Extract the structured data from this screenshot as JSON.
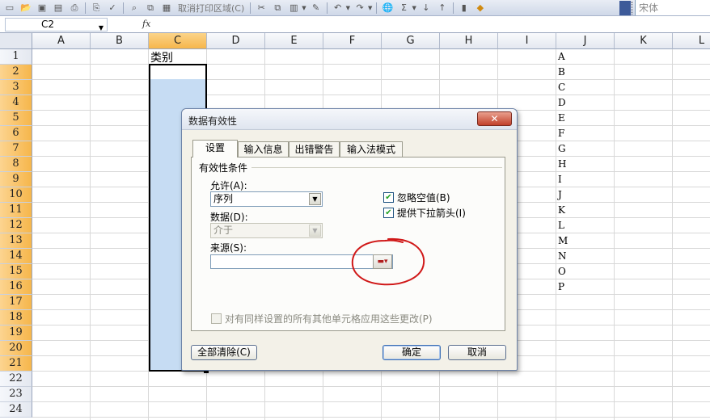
{
  "toolbar": {
    "cancel_print_area_label": "取消打印区域(C)",
    "font_name": "宋体",
    "icons": [
      "new-icon",
      "open-icon",
      "save-icon",
      "permission-icon",
      "print-icon",
      "print-preview-icon",
      "spelling-icon",
      "research-icon",
      "copy-icon",
      "paste-icon",
      "cut-icon",
      "paste-special-icon",
      "format-painter-icon",
      "undo-icon",
      "redo-icon",
      "hyperlink-icon",
      "autosum-icon",
      "sort-asc-icon",
      "sort-desc-icon",
      "chart-icon",
      "drawing-icon"
    ]
  },
  "formula_bar": {
    "cell_ref": "C2",
    "fx_label": "fx",
    "value": ""
  },
  "grid": {
    "columns": [
      "A",
      "B",
      "C",
      "D",
      "E",
      "F",
      "G",
      "H",
      "I",
      "J",
      "K",
      "L"
    ],
    "rows": [
      "1",
      "2",
      "3",
      "4",
      "5",
      "6",
      "7",
      "8",
      "9",
      "10",
      "11",
      "12",
      "13",
      "14",
      "15",
      "16",
      "17",
      "18",
      "19",
      "20",
      "21",
      "22",
      "23",
      "24"
    ],
    "selected_column": "C",
    "c1": "类别",
    "column_j": [
      "A",
      "B",
      "C",
      "D",
      "E",
      "F",
      "G",
      "H",
      "I",
      "J",
      "K",
      "L",
      "M",
      "N",
      "O",
      "P"
    ]
  },
  "dialog": {
    "title": "数据有效性",
    "close_label": "✕",
    "tabs": [
      "设置",
      "输入信息",
      "出错警告",
      "输入法模式"
    ],
    "active_tab": "设置",
    "group_label": "有效性条件",
    "allow_label": "允许(A):",
    "allow_value": "序列",
    "data_label": "数据(D):",
    "data_value": "介于",
    "source_label": "来源(S):",
    "source_value": "",
    "ignore_blank_label": "忽略空值(B)",
    "ignore_blank_checked": true,
    "dropdown_label": "提供下拉箭头(I)",
    "dropdown_checked": true,
    "apply_all_label": "对有同样设置的所有其他单元格应用这些更改(P)",
    "apply_all_checked": false,
    "clear_all_label": "全部清除(C)",
    "ok_label": "确定",
    "cancel_label": "取消"
  },
  "colors": {
    "selection_fill": "#c6dcf3",
    "header_selected": "#f6b64b",
    "annotation_red": "#d01818"
  }
}
